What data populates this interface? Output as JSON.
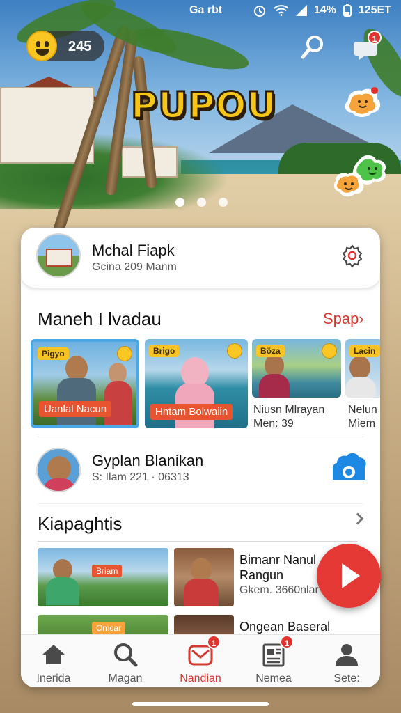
{
  "status_bar": {
    "time": "Ga rbt",
    "battery": "14%",
    "clock": "125ET"
  },
  "header": {
    "coin_count": "245",
    "brand": "PUPOU",
    "notification_count": "1"
  },
  "profile": {
    "name": "Mchal Fiapk",
    "subtitle": "Gcina 209 Manm"
  },
  "featured": {
    "title": "Maneh I lvadau",
    "link": "Spap",
    "items": [
      {
        "tag": "Pigyo",
        "caption": "Uanlal Nacun"
      },
      {
        "tag": "Brigo",
        "caption": "Hntam Bolwaiin"
      },
      {
        "tag": "Böza",
        "name": "Niusn Mlrayan",
        "meta": "Men: 39"
      },
      {
        "tag": "Lacin",
        "name": "Nelun",
        "meta": "Miem"
      }
    ]
  },
  "contact": {
    "name": "Gyplan Blanikan",
    "subtitle": "S: Ilam 221 · 06313"
  },
  "section2": {
    "title": "Kiapaghtis",
    "items": [
      {
        "tag": "Briam",
        "title_line1": "Birnanr Nanul",
        "title_line2": "Rangun",
        "sub": "Gkem. 3660nlar"
      },
      {
        "tag": "Omcar",
        "title_line1": "Ongean Baseral"
      }
    ]
  },
  "nav": {
    "items": [
      {
        "label": "Inerida",
        "icon": "home-icon"
      },
      {
        "label": "Magan",
        "icon": "search-icon"
      },
      {
        "label": "Nandian",
        "icon": "mail-icon",
        "badge": "1",
        "active": true
      },
      {
        "label": "Nemea",
        "icon": "news-icon",
        "badge": "1"
      },
      {
        "label": "Sete:",
        "icon": "profile-icon"
      }
    ]
  },
  "colors": {
    "accent": "#e53935",
    "brand_yellow": "#f5c518",
    "link_red": "#d43a2f",
    "tag_yellow": "#f7c325",
    "caption_orange": "#e8542f",
    "icon_blue": "#1e88e5"
  }
}
